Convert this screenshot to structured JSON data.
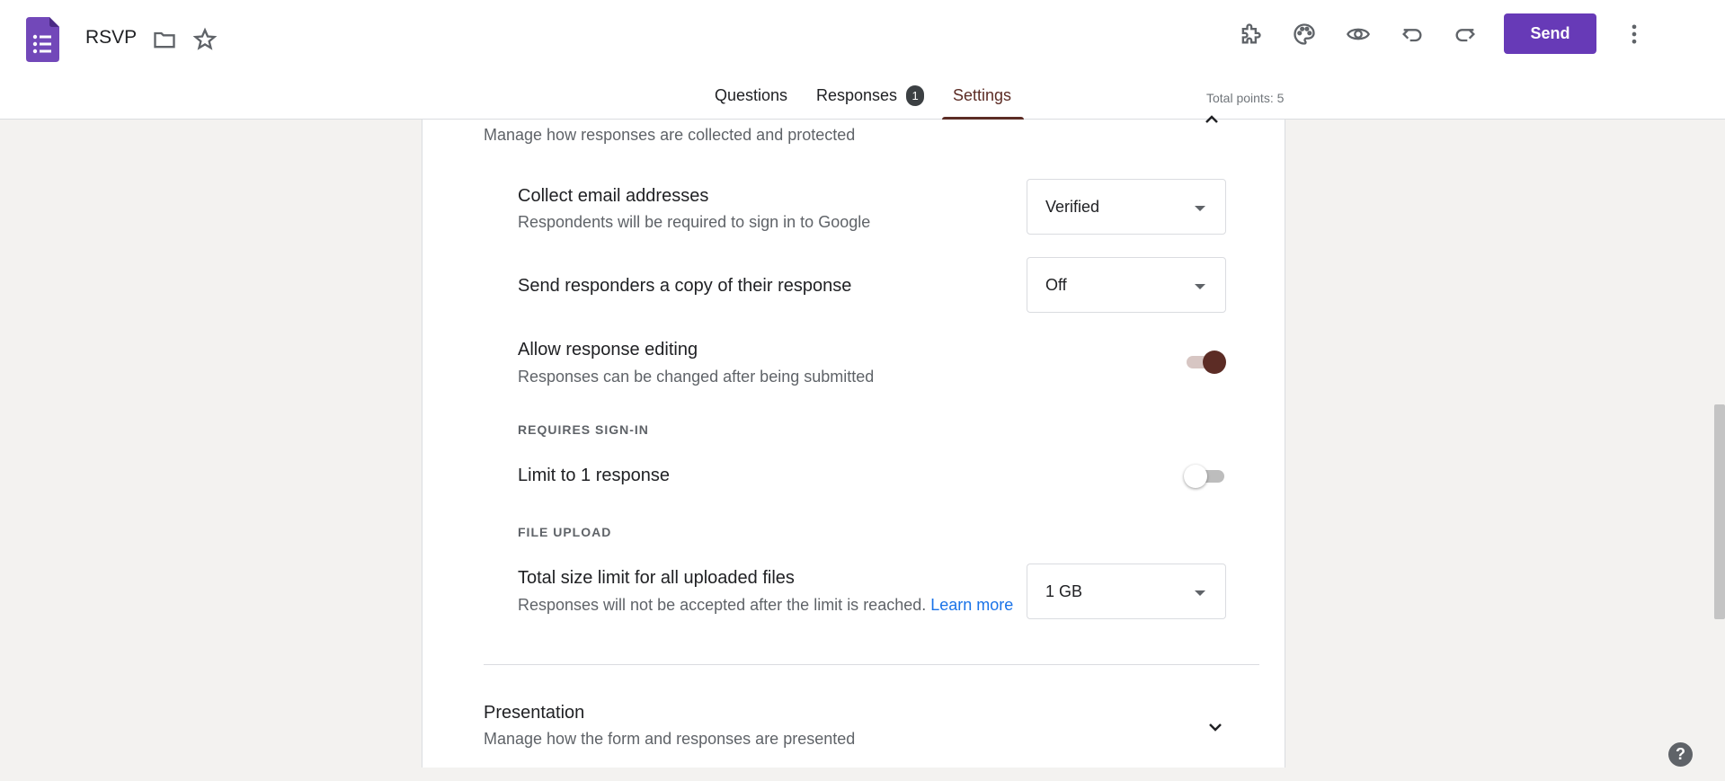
{
  "header": {
    "title": "RSVP",
    "send_label": "Send",
    "icons": [
      "forms-logo-icon",
      "folder-icon",
      "star-icon",
      "addon-puzzle-icon",
      "palette-icon",
      "preview-eye-icon",
      "undo-icon",
      "redo-icon",
      "more-vert-icon"
    ]
  },
  "tabs": [
    {
      "label": "Questions",
      "active": false
    },
    {
      "label": "Responses",
      "badge": "1",
      "active": false
    },
    {
      "label": "Settings",
      "active": true
    }
  ],
  "total_points": "Total points: 5",
  "responses_section": {
    "subtitle": "Manage how responses are collected and protected",
    "collect_email": {
      "label": "Collect email addresses",
      "desc": "Respondents will be required to sign in to Google",
      "value": "Verified"
    },
    "send_copy": {
      "label": "Send responders a copy of their response",
      "value": "Off"
    },
    "allow_editing": {
      "label": "Allow response editing",
      "desc": "Responses can be changed after being submitted",
      "on": true
    },
    "requires_signin_heading": "REQUIRES SIGN-IN",
    "limit_one": {
      "label": "Limit to 1 response",
      "on": false
    },
    "file_upload_heading": "FILE UPLOAD",
    "size_limit": {
      "label": "Total size limit for all uploaded files",
      "desc": "Responses will not be accepted after the limit is reached.",
      "learn_more": "Learn more",
      "value": "1 GB"
    }
  },
  "presentation_section": {
    "title": "Presentation",
    "subtitle": "Manage how the form and responses are presented"
  },
  "help_label": "?",
  "colors": {
    "brand": "#673ab7",
    "accent": "#5c2c25",
    "link": "#1a73e8"
  }
}
